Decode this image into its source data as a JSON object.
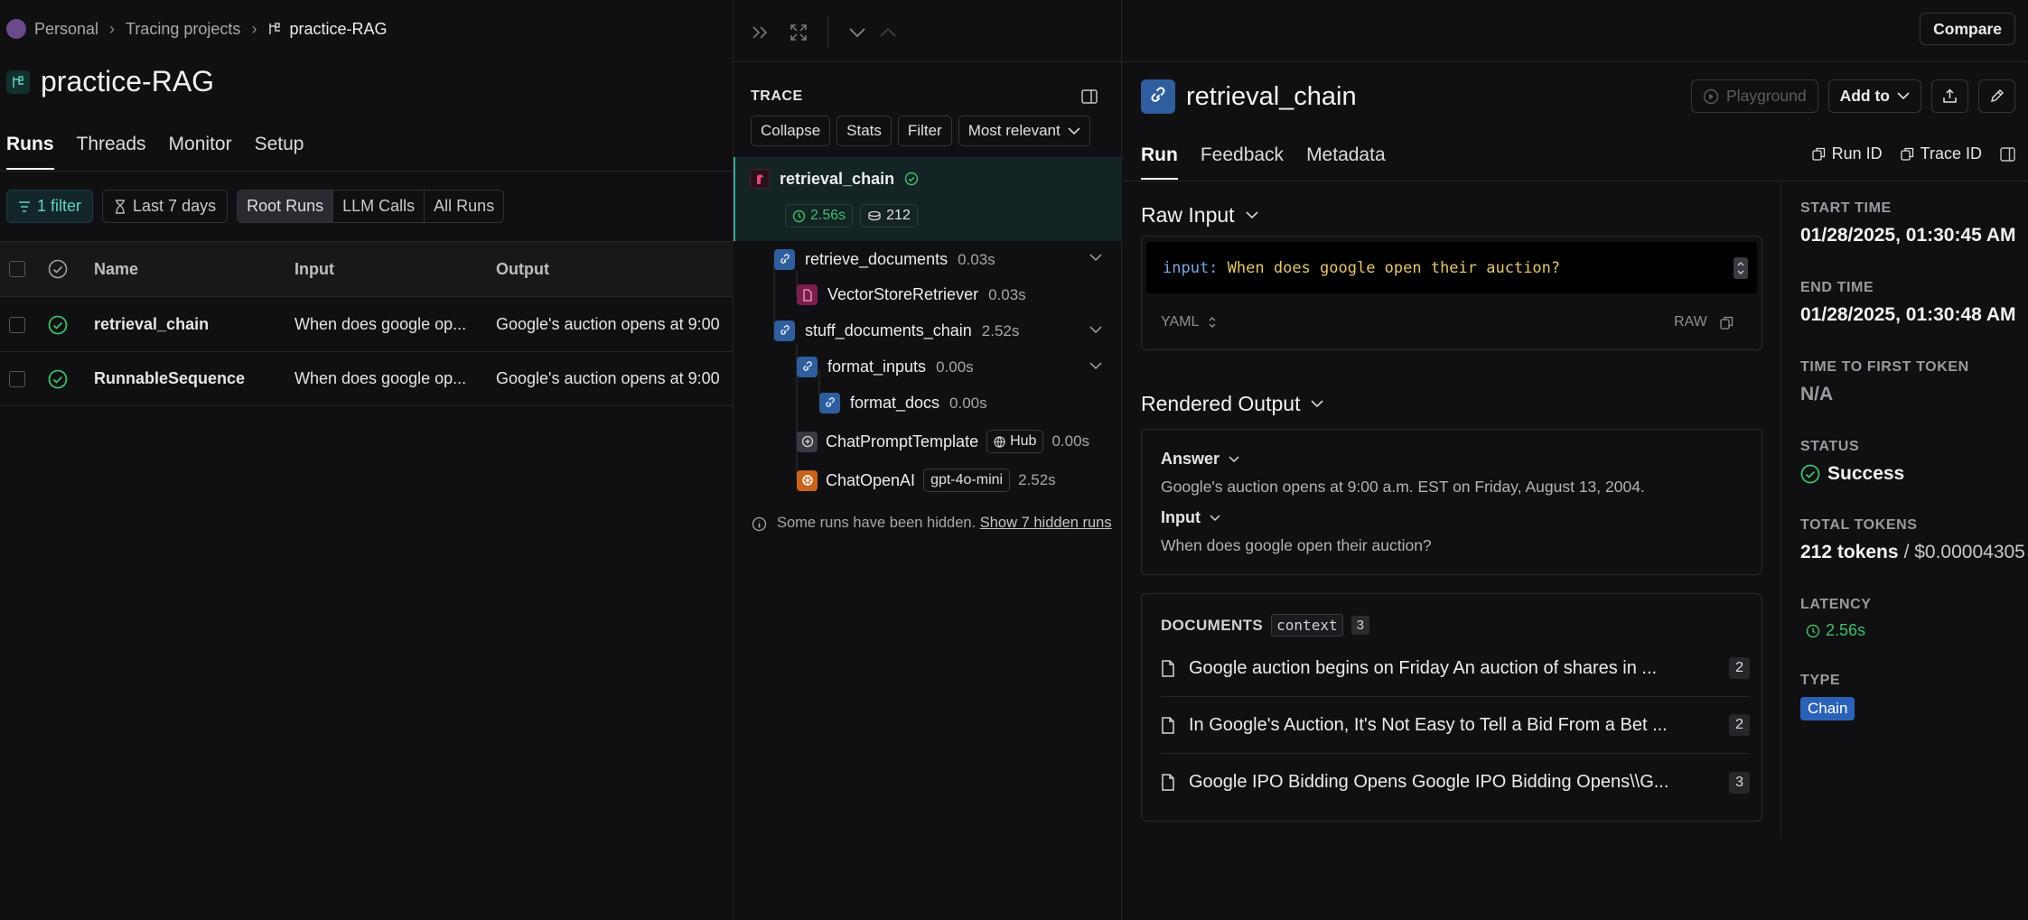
{
  "breadcrumb": {
    "items": [
      "Personal",
      "Tracing projects",
      "practice-RAG"
    ]
  },
  "project": {
    "title": "practice-RAG"
  },
  "left_tabs": [
    "Runs",
    "Threads",
    "Monitor",
    "Setup"
  ],
  "filters": {
    "filter_chip": "1 filter",
    "time_range": "Last 7 days",
    "run_types": [
      "Root Runs",
      "LLM Calls",
      "All Runs"
    ]
  },
  "table": {
    "columns": [
      "Name",
      "Input",
      "Output"
    ],
    "rows": [
      {
        "name": "retrieval_chain",
        "input": "When does google op...",
        "output": "Google's auction opens at 9:00"
      },
      {
        "name": "RunnableSequence",
        "input": "When does google op...",
        "output": "Google's auction opens at 9:00"
      }
    ]
  },
  "trace": {
    "label": "TRACE",
    "buttons": [
      "Collapse",
      "Stats",
      "Filter",
      "Most relevant"
    ],
    "root": {
      "name": "retrieval_chain",
      "latency": "2.56s",
      "tokens": "212"
    },
    "nodes": [
      {
        "name": "retrieve_documents",
        "duration": "0.03s"
      },
      {
        "name": "VectorStoreRetriever",
        "duration": "0.03s"
      },
      {
        "name": "stuff_documents_chain",
        "duration": "2.52s"
      },
      {
        "name": "format_inputs",
        "duration": "0.00s"
      },
      {
        "name": "format_docs",
        "duration": "0.00s"
      },
      {
        "name": "ChatPromptTemplate",
        "tag": "Hub",
        "duration": "0.00s"
      },
      {
        "name": "ChatOpenAI",
        "tag": "gpt-4o-mini",
        "duration": "2.52s"
      }
    ],
    "hidden_note": "Some runs have been hidden.",
    "hidden_link": "Show 7 hidden runs"
  },
  "run": {
    "title": "retrieval_chain",
    "actions": {
      "playground": "Playground",
      "add_to": "Add to",
      "compare": "Compare"
    },
    "tabs": [
      "Run",
      "Feedback",
      "Metadata"
    ],
    "id_buttons": [
      "Run ID",
      "Trace ID"
    ],
    "raw_input": {
      "title": "Raw Input",
      "key": "input:",
      "value": "When does google open their auction?",
      "format": "YAML",
      "mode": "RAW"
    },
    "rendered_output": {
      "title": "Rendered Output",
      "answer_label": "Answer",
      "answer": "Google's auction opens at 9:00 a.m. EST on Friday, August 13, 2004.",
      "input_label": "Input",
      "input": "When does google open their auction?"
    },
    "documents": {
      "label": "DOCUMENTS",
      "key": "context",
      "count": "3",
      "items": [
        {
          "title": "Google auction begins on Friday An auction of shares in ...",
          "n": "2"
        },
        {
          "title": "In Google's Auction, It's Not Easy to Tell a Bid From a Bet ...",
          "n": "2"
        },
        {
          "title": "Google IPO Bidding Opens Google IPO Bidding Opens\\\\G...",
          "n": "3"
        }
      ]
    },
    "meta": {
      "start_label": "START TIME",
      "start": "01/28/2025, 01:30:45 AM",
      "end_label": "END TIME",
      "end": "01/28/2025, 01:30:48 AM",
      "ttft_label": "TIME TO FIRST TOKEN",
      "ttft": "N/A",
      "status_label": "STATUS",
      "status": "Success",
      "tokens_label": "TOTAL TOKENS",
      "tokens": "212 tokens",
      "cost": "/ $0.00004305",
      "latency_label": "LATENCY",
      "latency": "2.56s",
      "type_label": "TYPE",
      "type": "Chain"
    }
  },
  "colors": {
    "accent_teal": "#5fd3c4",
    "success": "#3fbf6b",
    "chain_badge": "#2a62b8"
  }
}
